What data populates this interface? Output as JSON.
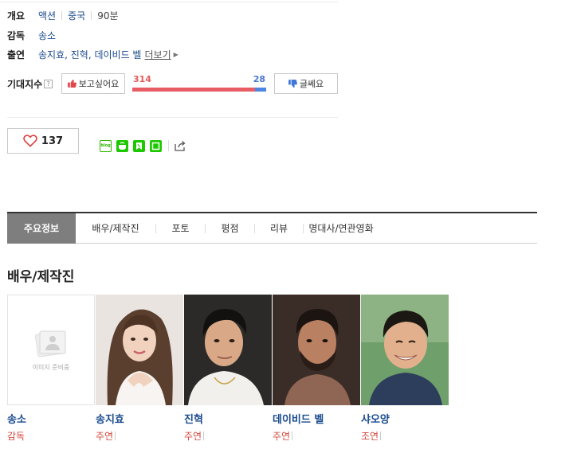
{
  "info": {
    "genre_label": "개요",
    "genre": "액션",
    "country": "중국",
    "runtime": "90분",
    "director_label": "감독",
    "director": "송소",
    "cast_label": "출연",
    "cast": "송지효, 진혁, 데이비드 벨",
    "more": "더보기"
  },
  "expect": {
    "label": "기대지수",
    "help": "?",
    "want_label": "보고싶어요",
    "doubt_label": "글쎄요",
    "want_count": "314",
    "doubt_count": "28",
    "want_fraction": 0.918
  },
  "like": {
    "count": "137"
  },
  "tabs": [
    "주요정보",
    "배우/제작진",
    "포토",
    "평점",
    "리뷰",
    "명대사/연관영화"
  ],
  "section_title": "배우/제작진",
  "people": [
    {
      "name": "송소",
      "role": "감독",
      "placeholder": "이미지 준비중"
    },
    {
      "name": "송지효",
      "role": "주연"
    },
    {
      "name": "진혁",
      "role": "주연"
    },
    {
      "name": "데이비드 벨",
      "role": "주연"
    },
    {
      "name": "샤오양",
      "role": "조연"
    }
  ],
  "colors": {
    "link": "#1a4b8e",
    "role": "#d2483e",
    "want": "#e85d63",
    "doubt": "#4d86e0",
    "active_tab": "#7e7e7e"
  }
}
